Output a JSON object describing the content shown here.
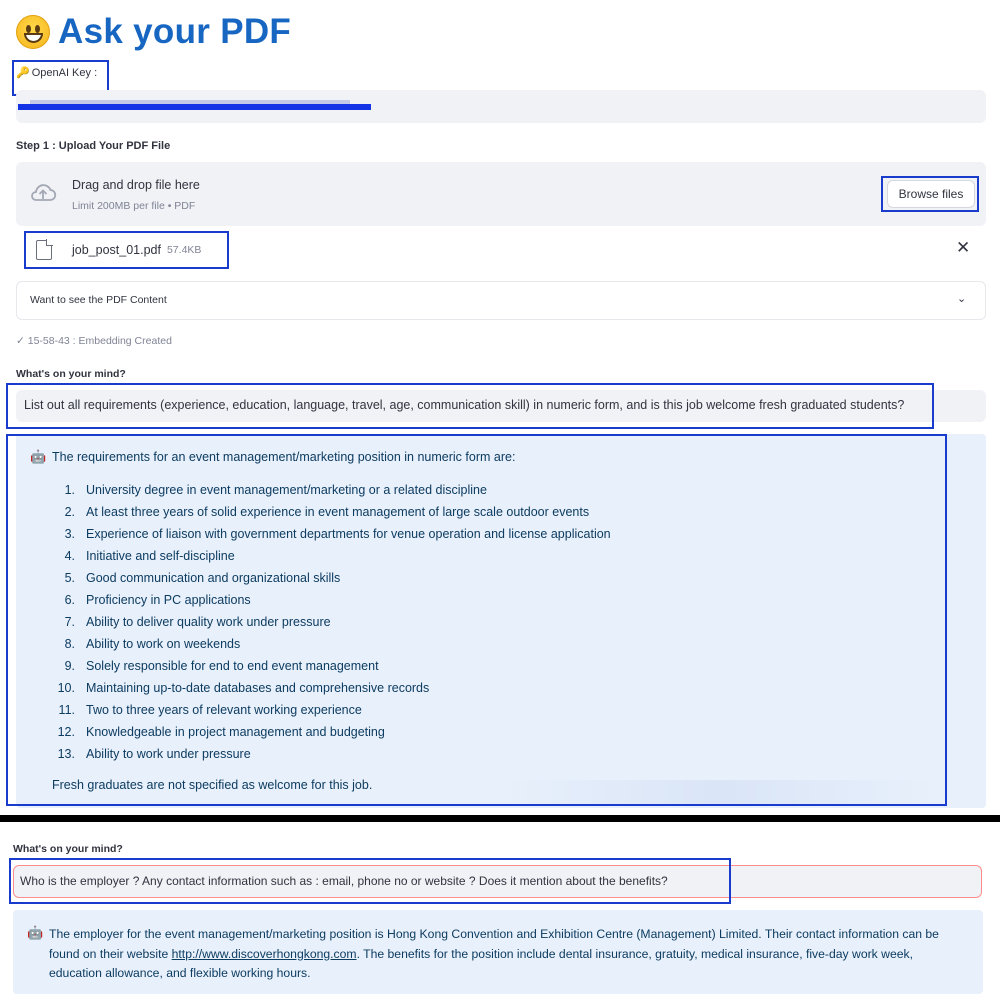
{
  "header": {
    "title_text": "Ask your PDF",
    "emoji_icon": "grinning-face-icon",
    "title_color": "#1766c2"
  },
  "api_key": {
    "label": "OpenAI Key :",
    "icon": "key-icon"
  },
  "upload": {
    "step_label": "Step 1 : Upload Your PDF File",
    "drag_text": "Drag and drop file here",
    "limit_text": "Limit 200MB per file • PDF",
    "browse_label": "Browse files",
    "file": {
      "name": "job_post_01.pdf",
      "size": "57.4KB"
    },
    "expander_label": "Want to see the PDF Content",
    "status": "15-58-43 : Embedding Created"
  },
  "chat": [
    {
      "question_label": "What's on your mind?",
      "question": "List out all requirements (experience, education, language, travel, age,  communication skill) in numeric  form, and is this job welcome fresh graduated students?",
      "answer_intro": "The requirements for an event management/marketing position in numeric form are:",
      "answer_items": [
        {
          "num": "1.",
          "text": "University degree in event management/marketing or a related discipline"
        },
        {
          "num": "2.",
          "text": "At least three years of solid experience in event management of large scale outdoor events"
        },
        {
          "num": "3.",
          "text": "Experience of liaison with government departments for venue operation and license application"
        },
        {
          "num": "4.",
          "text": "Initiative and self-discipline"
        },
        {
          "num": "5.",
          "text": "Good communication and organizational skills"
        },
        {
          "num": "6.",
          "text": "Proficiency in PC applications"
        },
        {
          "num": "7.",
          "text": "Ability to deliver quality work under pressure"
        },
        {
          "num": "8.",
          "text": "Ability to work on weekends"
        },
        {
          "num": "9.",
          "text": "Solely responsible for end to end event management"
        },
        {
          "num": "10.",
          "text": "Maintaining up-to-date databases and comprehensive records"
        },
        {
          "num": "11.",
          "text": "Two to three years of relevant working experience"
        },
        {
          "num": "12.",
          "text": "Knowledgeable in project management and budgeting"
        },
        {
          "num": "13.",
          "text": "Ability to work under pressure"
        }
      ],
      "answer_footer": "Fresh graduates are not specified as welcome for this job."
    },
    {
      "question_label": "What's on your mind?",
      "question": "Who is the employer ? Any contact information such as : email, phone no or website ?  Does it mention about the benefits?",
      "answer_part1": "The employer for the event management/marketing position is Hong Kong Convention and Exhibition Centre (Management) Limited. Their contact information can be found on their website ",
      "answer_link": "http://www.discoverhongkong.com",
      "answer_part2": ". The benefits for the position include dental insurance, gratuity, medical insurance, five-day work week, education allowance, and flexible working hours."
    }
  ],
  "colors": {
    "highlight_box": "#1a3ccc",
    "answer_bg": "#e8f0fb",
    "input_bg": "#f0f2f6",
    "answer_text": "#0d3c61"
  }
}
